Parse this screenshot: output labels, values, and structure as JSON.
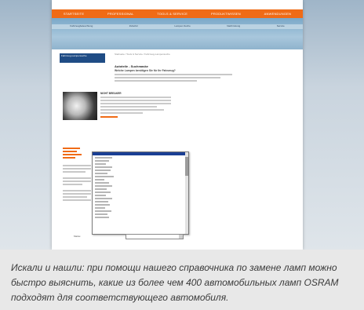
{
  "screenshot": {
    "top_nav": [
      "STARTSEITE",
      "PROFESSIONAL",
      "TOOLS & SERVICE",
      "PRODUKTWISSEN",
      "ANWENDUNGEN"
    ],
    "sub_nav": [
      "Fahrzeugbeleuchtung",
      "Zubehör",
      "Lampen-Suche",
      "Nachrüstung",
      "Service"
    ],
    "sidebar_label": "Fahrzeug-Lampensuche",
    "breadcrumb": "Startseite / Tools & Service / Fahrzeug-Lampensuche",
    "heading": "Autoteile - Suchmaske",
    "subheading": "Welche Lampen benötigen Sie für Ihr Fahrzeug?",
    "feature_title": "NIGHT BREAKER",
    "combo_label": "Marke:"
  },
  "caption": "Искали и нашли: при помощи нашего справочника по замене ламп можно быстро выяснить, какие из более чем 400 автомобильных ламп OSRAM подходят для соответствующего автомобиля.",
  "colors": {
    "accent": "#f06b16",
    "selection": "#1a3f94",
    "sidebar": "#1f4c85",
    "caption_bg": "#e8e8e8"
  }
}
